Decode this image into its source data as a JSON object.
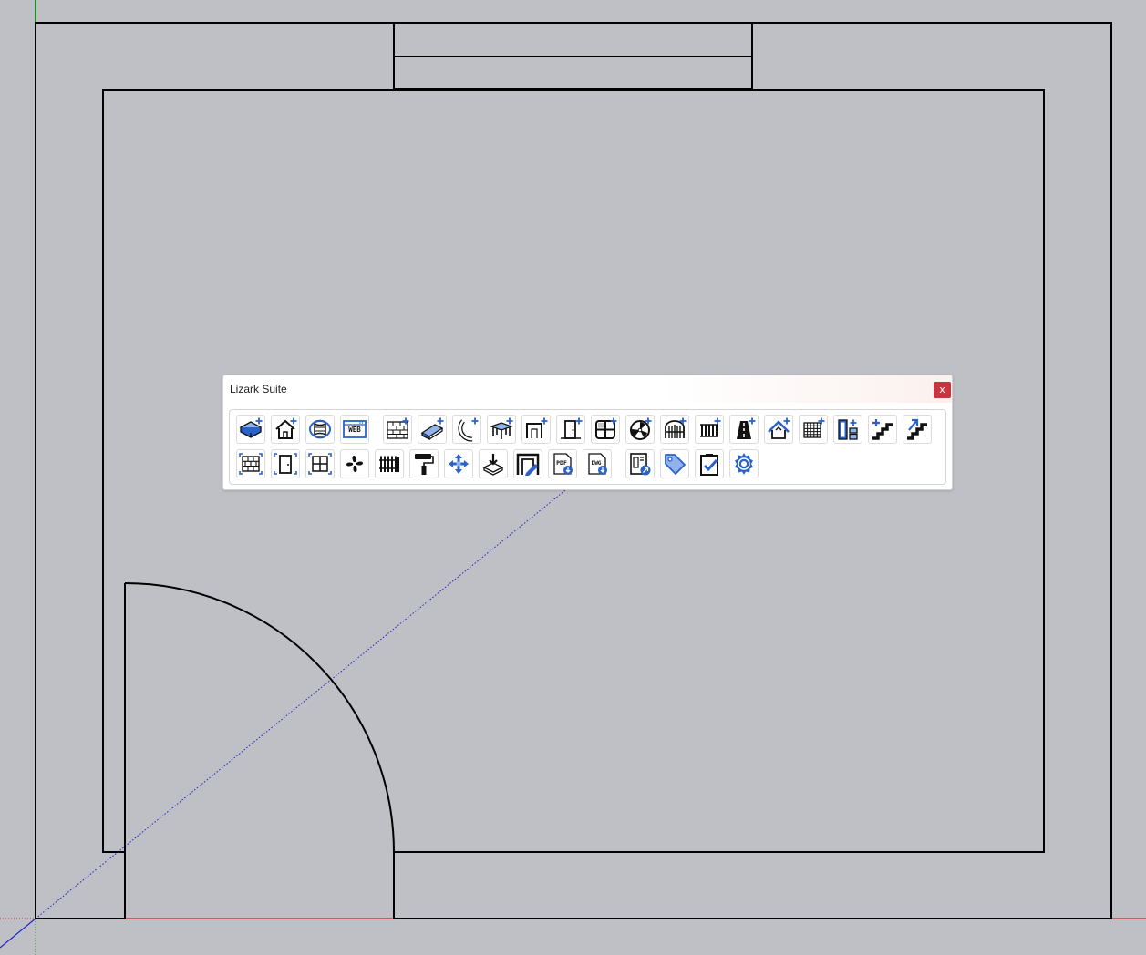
{
  "window": {
    "title": "Lizark Suite",
    "close_label": "x"
  },
  "colors": {
    "background": "#bfc0c5",
    "icon_dark": "#111111",
    "icon_blue": "#2a62c9",
    "icon_light_blue": "#8fb3ea",
    "close_red": "#c8343f",
    "axis_red": "#d0202a",
    "axis_green": "#1a8a1a",
    "axis_blue": "#2222cc"
  },
  "toolbar": {
    "row1": [
      {
        "name": "floor-slab-icon"
      },
      {
        "name": "house-add-icon"
      },
      {
        "name": "cylinder-rotate-icon"
      },
      {
        "name": "web-icon",
        "text": "WEB"
      },
      {
        "name": "wall-add-icon"
      },
      {
        "name": "beam-add-icon"
      },
      {
        "name": "curved-wall-add-icon"
      },
      {
        "name": "table-add-icon"
      },
      {
        "name": "opening-add-icon"
      },
      {
        "name": "door-add-icon"
      },
      {
        "name": "window-add-icon"
      },
      {
        "name": "fan-add-icon"
      },
      {
        "name": "gate-add-icon"
      },
      {
        "name": "radiator-add-icon"
      },
      {
        "name": "road-add-icon"
      },
      {
        "name": "roof-add-icon"
      },
      {
        "name": "grid-add-icon"
      },
      {
        "name": "column-layout-icon"
      },
      {
        "name": "stairs-add-icon"
      },
      {
        "name": "stairs-up-icon"
      }
    ],
    "row2": [
      {
        "name": "wall-select-icon"
      },
      {
        "name": "door-select-icon"
      },
      {
        "name": "window-select-icon"
      },
      {
        "name": "fan-icon"
      },
      {
        "name": "fence-icon"
      },
      {
        "name": "paint-roller-icon"
      },
      {
        "name": "move-icon"
      },
      {
        "name": "import-layer-icon"
      },
      {
        "name": "frame-edit-icon"
      },
      {
        "name": "pdf-export-icon",
        "text": "PDF"
      },
      {
        "name": "dwg-export-icon",
        "text": "DWG"
      },
      {
        "name": "layout-export-icon"
      },
      {
        "name": "tag-icon"
      },
      {
        "name": "clipboard-check-icon"
      },
      {
        "name": "settings-gear-icon"
      }
    ]
  }
}
